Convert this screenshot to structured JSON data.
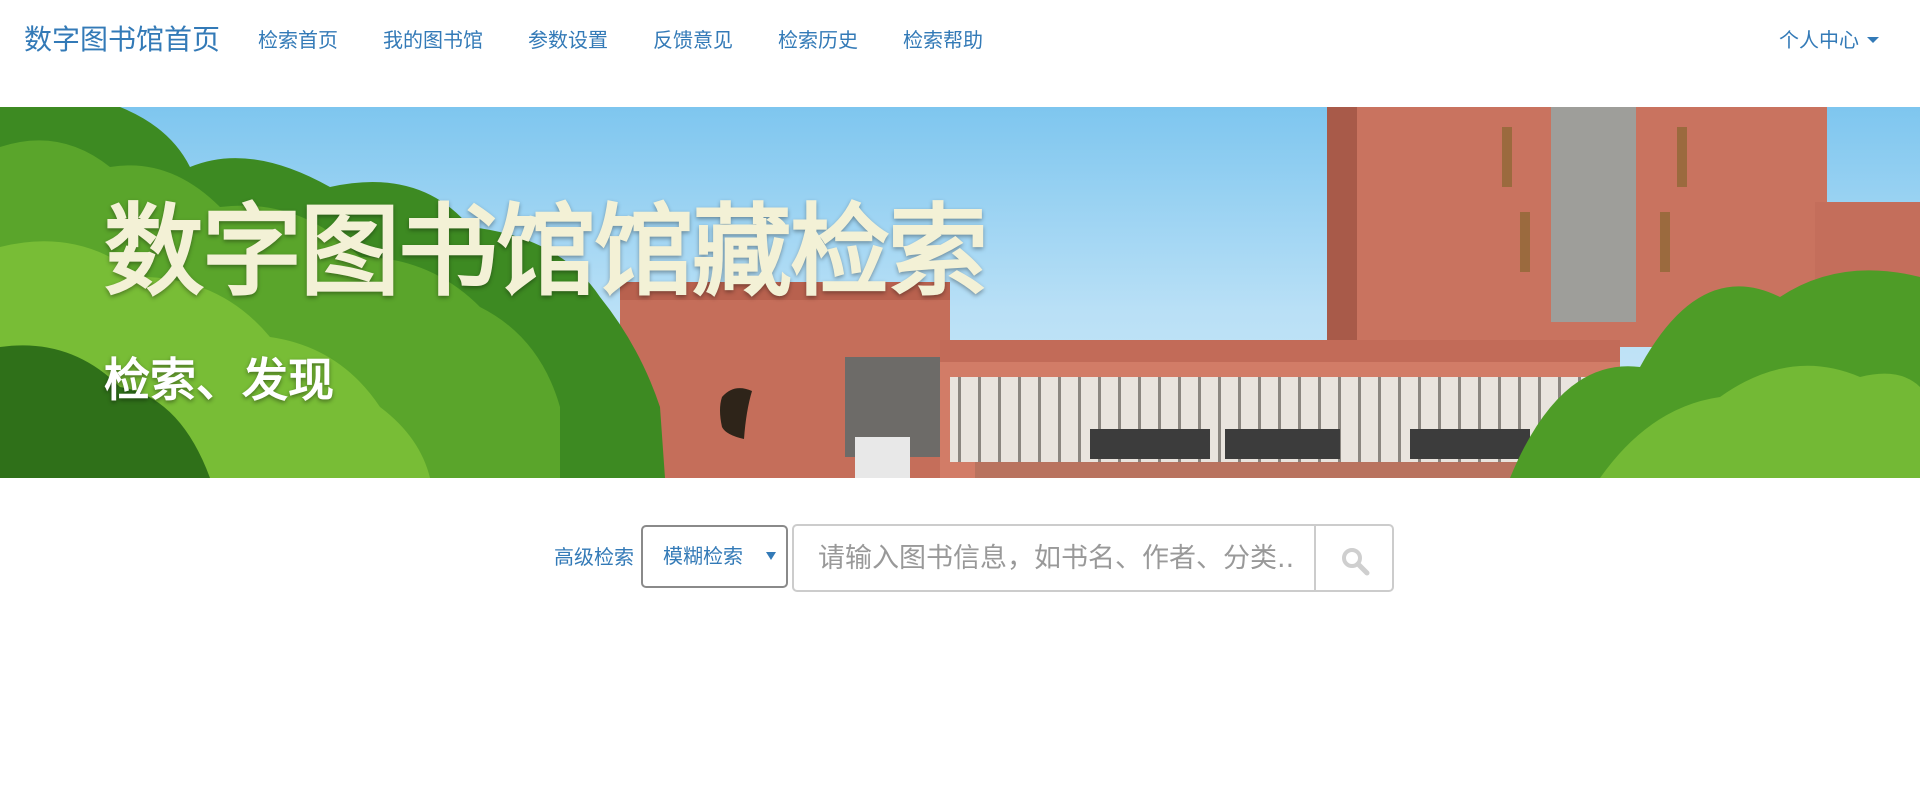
{
  "navbar": {
    "brand": "数字图书馆首页",
    "links": [
      "检索首页",
      "我的图书馆",
      "参数设置",
      "反馈意见",
      "检索历史",
      "检索帮助"
    ],
    "user_menu": "个人中心"
  },
  "banner": {
    "title": "数字图书馆馆藏检索",
    "subtitle": "检索、发现"
  },
  "search": {
    "advanced_link": "高级检索",
    "mode_selected": "模糊检索",
    "placeholder": "请输入图书信息，如书名、作者、分类..",
    "button_icon": "search-icon"
  },
  "colors": {
    "link": "#337ab7",
    "banner_title": "#f3f1d6",
    "input_border": "#cccccc"
  }
}
